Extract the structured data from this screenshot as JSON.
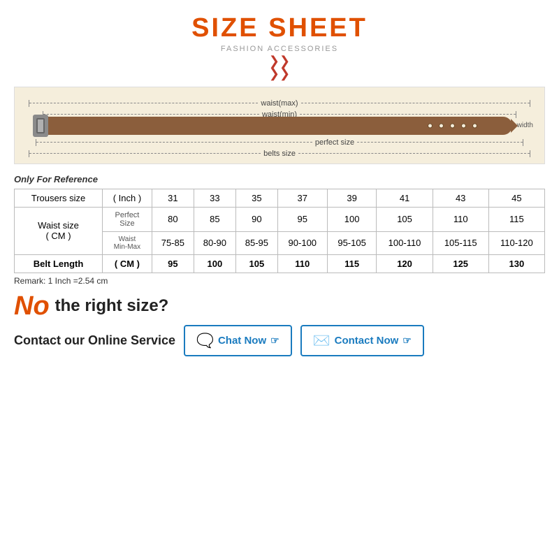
{
  "header": {
    "title": "SIZE SHEET",
    "subtitle": "FASHION ACCESSORIES"
  },
  "belt_diagram": {
    "labels": {
      "waist_max": "waist(max)",
      "waist_min": "waist(min)",
      "perfect_size": "perfect size",
      "belts_size": "belts size",
      "width": "width"
    }
  },
  "reference_text": "Only For Reference",
  "table": {
    "col_headers": [
      "Trousers size",
      "( Inch )",
      "31",
      "33",
      "35",
      "37",
      "39",
      "41",
      "43",
      "45"
    ],
    "rows": [
      {
        "row_header": "Waist size\n( CM )",
        "sub_header": "Perfect\nSize",
        "values": [
          "80",
          "85",
          "90",
          "95",
          "100",
          "105",
          "110",
          "115"
        ]
      },
      {
        "sub_header": "Waist\nMin-Max",
        "values": [
          "75-85",
          "80-90",
          "85-95",
          "90-100",
          "95-105",
          "100-110",
          "105-115",
          "110-120"
        ]
      },
      {
        "row_header": "Belt Length",
        "sub_header": "( CM )",
        "values": [
          "95",
          "100",
          "105",
          "110",
          "115",
          "120",
          "125",
          "130"
        ],
        "bold": true
      }
    ]
  },
  "remark": "Remark: 1 Inch =2.54 cm",
  "no_size": {
    "no_label": "No",
    "question": "the right size?"
  },
  "contact": {
    "label": "Contact our Online Service",
    "chat_now": "Chat Now",
    "contact_now": "Contact Now"
  }
}
